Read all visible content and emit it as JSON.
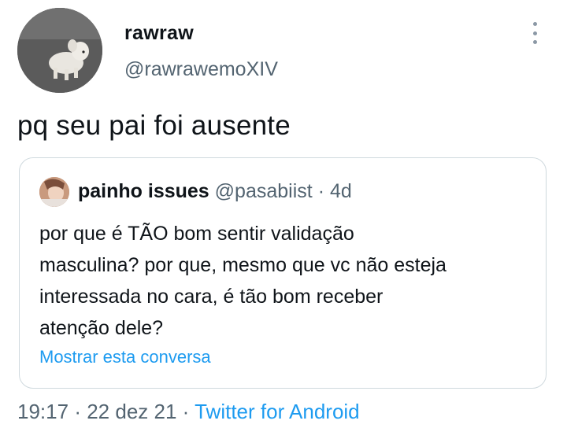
{
  "tweet": {
    "author": {
      "display_name": "rawraw",
      "handle": "@rawrawemoXIV"
    },
    "text": "pq seu pai foi ausente",
    "quoted": {
      "display_name": "painho issues",
      "handle": "@pasabiist",
      "separator": "·",
      "age": "4d",
      "lines": [
        "por que é TÃO bom sentir validação",
        "masculina? por que, mesmo que vc não esteja",
        "interessada no cara, é tão bom receber",
        "atenção dele?"
      ],
      "show_thread": "Mostrar esta conversa"
    },
    "footer": {
      "time": "19:17",
      "sep1": "·",
      "date": "22 dez 21",
      "sep2": "·",
      "source": "Twitter for Android"
    }
  },
  "icons": {
    "more": "more-vertical-icon"
  },
  "colors": {
    "link": "#1d9bf0",
    "secondary_text": "#536471",
    "border": "#cfd9de"
  }
}
